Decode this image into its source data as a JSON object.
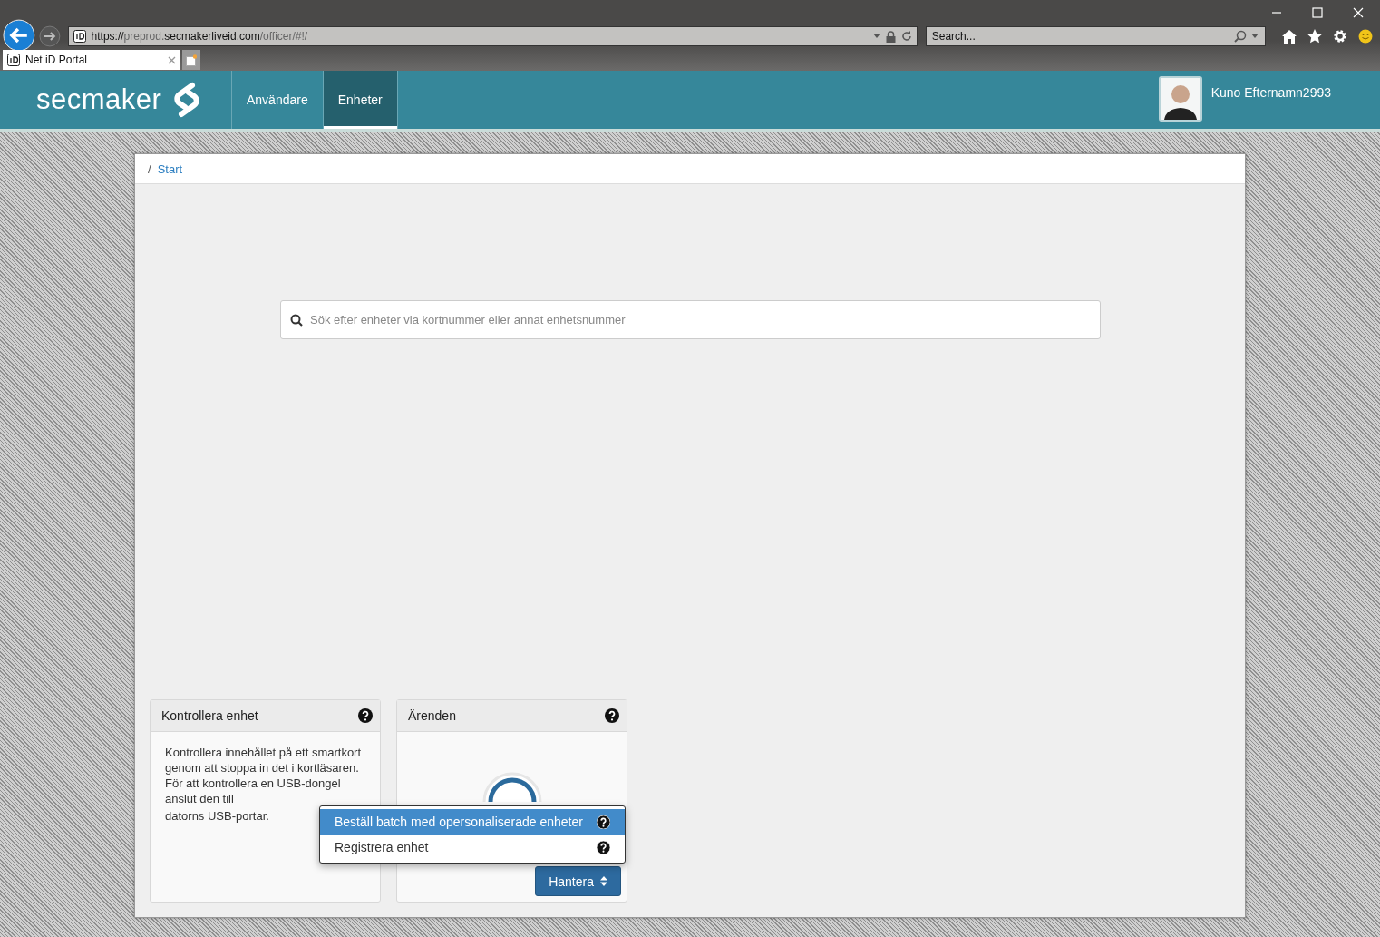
{
  "browser": {
    "url_parts": [
      {
        "text": "https://",
        "strong": true
      },
      {
        "text": "preprod.",
        "strong": false
      },
      {
        "text": "secmakerliveid.com",
        "strong": true
      },
      {
        "text": "/officer/#!/",
        "strong": false
      }
    ],
    "search": {
      "placeholder": "Search..."
    },
    "tabs": [
      {
        "title": "Net iD Portal",
        "selected": true
      }
    ]
  },
  "header": {
    "logo_text": "secmaker",
    "nav": [
      {
        "label": "Användare",
        "selected": false
      },
      {
        "label": "Enheter",
        "selected": true
      }
    ],
    "user": {
      "name": "Kuno Efternamn2993"
    }
  },
  "breadcrumb": {
    "separator": "/",
    "items": [
      "Start"
    ]
  },
  "device_search": {
    "placeholder": "Sök efter enheter via kortnummer eller annat enhetsnummer"
  },
  "cards": [
    {
      "kind": "text",
      "title": "Kontrollera enhet",
      "body": "Kontrollera innehållet på ett smartkort genom att stoppa in det i kortläsaren. För att kontrollera en USB-dongel anslut den till",
      "body_tail": "datorns USB-portar."
    },
    {
      "kind": "counter",
      "title": "Ärenden",
      "button": "Hantera"
    }
  ],
  "menu": {
    "items": [
      {
        "label": "Beställ batch med opersonaliserade enheter",
        "selected": true
      },
      {
        "label": "Registrera enhet",
        "selected": false
      }
    ]
  }
}
